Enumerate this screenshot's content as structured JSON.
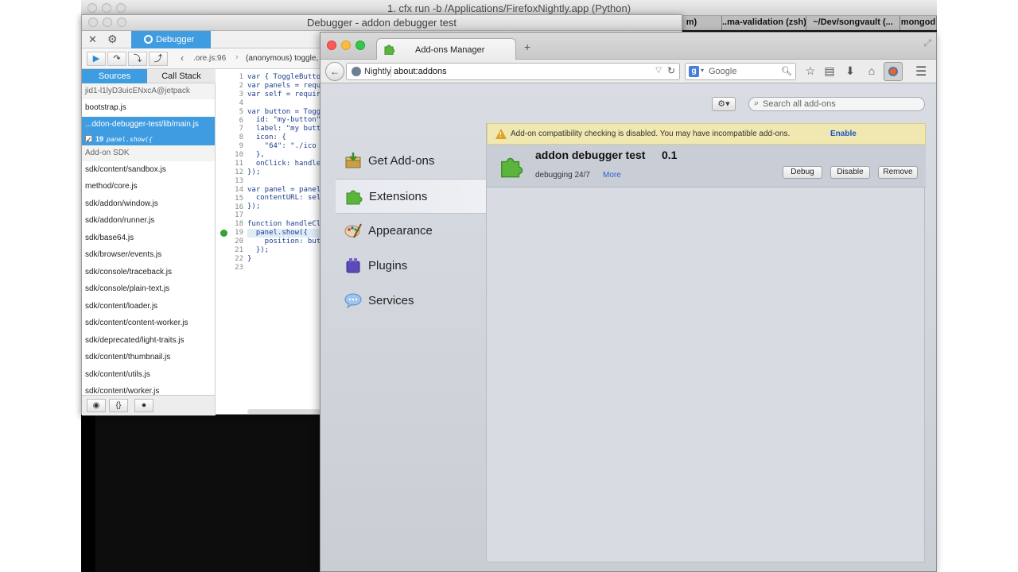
{
  "terminal": {
    "title": "1. cfx run -b /Applications/FirefoxNightly.app (Python)",
    "tabs": [
      "m)",
      "..ma-validation (zsh)",
      "~/Dev/songvault (...",
      "mongod"
    ]
  },
  "debugger": {
    "window_title": "Debugger - addon debugger test",
    "tab_label": "Debugger",
    "breadcrumb_file": ".ore.js:96",
    "breadcrumb_func": "(anonymous) toggle,",
    "panel_tabs": {
      "sources": "Sources",
      "callstack": "Call Stack"
    },
    "sources": {
      "group1": "jid1-l1lyD3uicENxcA@jetpack",
      "item_bootstrap": "bootstrap.js",
      "item_main": "...ddon-debugger-test/lib/main.js",
      "bp_line": "19",
      "bp_code": "panel.show({",
      "group2": "Add-on SDK",
      "items": [
        "sdk/content/sandbox.js",
        "method/core.js",
        "sdk/addon/window.js",
        "sdk/addon/runner.js",
        "sdk/base64.js",
        "sdk/browser/events.js",
        "sdk/console/traceback.js",
        "sdk/console/plain-text.js",
        "sdk/content/loader.js",
        "sdk/content/content-worker.js",
        "sdk/deprecated/light-traits.js",
        "sdk/content/thumbnail.js",
        "sdk/content/utils.js",
        "sdk/content/worker.js"
      ]
    },
    "line_numbers": [
      "1",
      "2",
      "3",
      "4",
      "5",
      "6",
      "7",
      "8",
      "9",
      "10",
      "11",
      "12",
      "13",
      "14",
      "15",
      "16",
      "17",
      "18",
      "19",
      "20",
      "21",
      "22",
      "23"
    ],
    "code_lines": [
      "var { ToggleButto",
      "var panels = requ",
      "var self = requir",
      "",
      "var button = Togg",
      "  id: \"my-button\"",
      "  label: \"my butt",
      "  icon: {",
      "    \"64\": \"./ico",
      "  },",
      "  onClick: handle",
      "});",
      "",
      "var panel = panel",
      "  contentURL: sel",
      "});",
      "",
      "function handleCl",
      "  panel.show({",
      "    position: but",
      "  });",
      "}",
      ""
    ],
    "breakpoint_line": 19
  },
  "browser": {
    "tab_title": "Add-ons Manager",
    "new_tab": "+",
    "url_brand": "Nightly",
    "url": "about:addons",
    "search_placeholder": "Google",
    "addons": {
      "search_placeholder": "Search all add-ons",
      "categories": [
        "Get Add-ons",
        "Extensions",
        "Appearance",
        "Plugins",
        "Services"
      ],
      "selected_category": "Extensions",
      "compat_warning": "Add-on compatibility checking is disabled. You may have incompatible add-ons.",
      "compat_link": "Enable",
      "addon": {
        "name": "addon debugger test",
        "version": "0.1",
        "description": "debugging 24/7",
        "more": "More",
        "buttons": {
          "debug": "Debug",
          "disable": "Disable",
          "remove": "Remove"
        }
      }
    }
  },
  "colors": {
    "debugger_accent": "#3f9ce0",
    "warning_bar": "#f0e8b0",
    "breakpoint": "#33a03a"
  }
}
